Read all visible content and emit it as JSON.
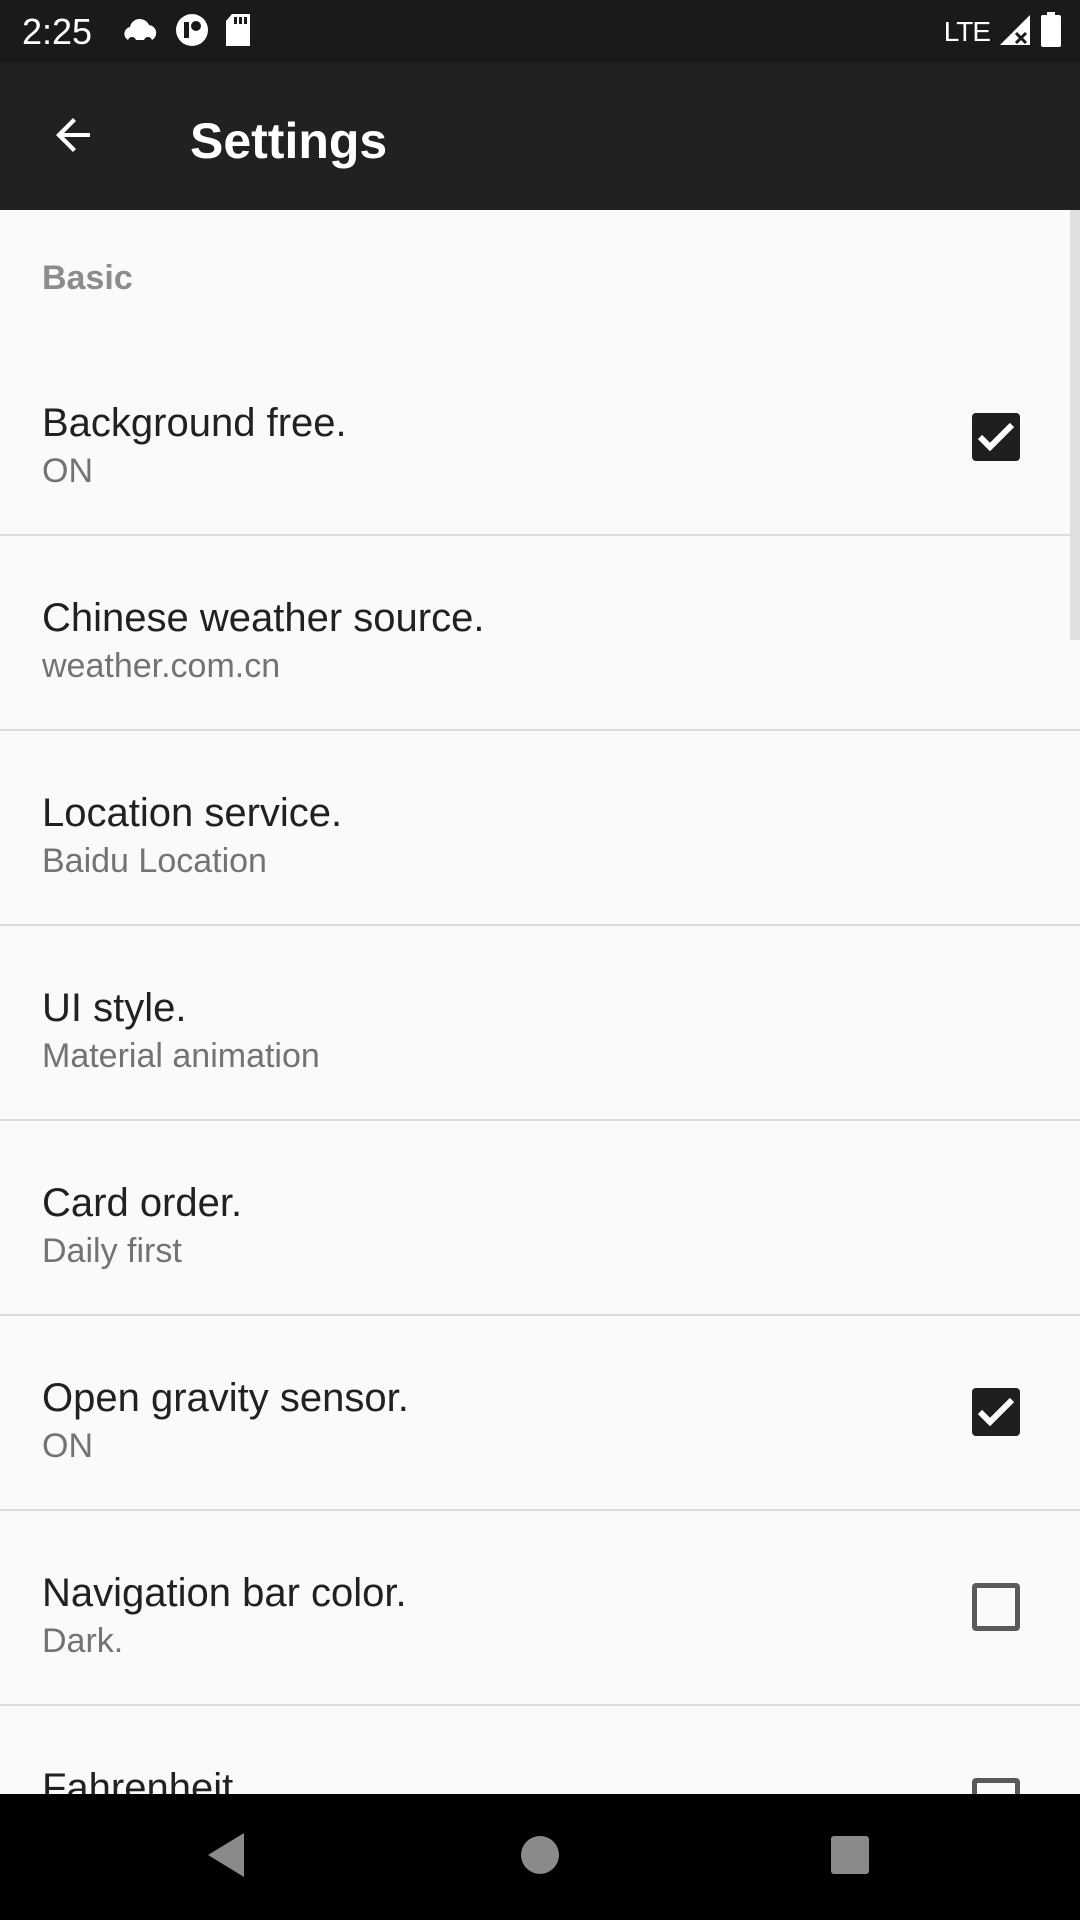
{
  "status_bar": {
    "time": "2:25",
    "network": "LTE",
    "icons_left": [
      "weather-cloud-icon",
      "app-notification-icon",
      "sd-card-icon"
    ],
    "icons_right": [
      "signal-icon",
      "battery-icon"
    ]
  },
  "app_bar": {
    "title": "Settings",
    "back_icon": "arrow-back-icon"
  },
  "section": {
    "title": "Basic"
  },
  "preferences": [
    {
      "title": "Background free.",
      "summary": "ON",
      "control": "checkbox",
      "checked": true
    },
    {
      "title": "Chinese weather source.",
      "summary": "weather.com.cn",
      "control": "none"
    },
    {
      "title": "Location service.",
      "summary": "Baidu Location",
      "control": "none"
    },
    {
      "title": "UI style.",
      "summary": "Material animation",
      "control": "none"
    },
    {
      "title": "Card order.",
      "summary": "Daily first",
      "control": "none"
    },
    {
      "title": "Open gravity sensor.",
      "summary": "ON",
      "control": "checkbox",
      "checked": true
    },
    {
      "title": "Navigation bar color.",
      "summary": "Dark.",
      "control": "checkbox",
      "checked": false
    },
    {
      "title": "Fahrenheit",
      "summary": "",
      "control": "checkbox",
      "checked": false
    }
  ],
  "nav_bar": {
    "buttons": [
      "back-triangle-icon",
      "home-circle-icon",
      "recents-square-icon"
    ]
  }
}
